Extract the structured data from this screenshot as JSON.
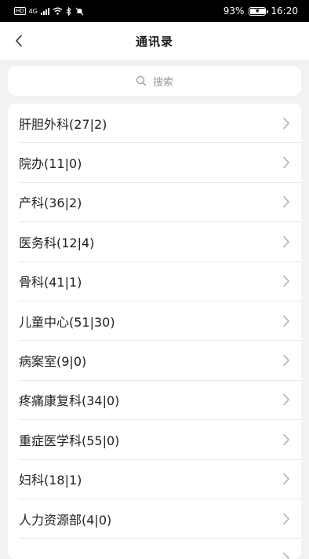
{
  "status_bar": {
    "network_tag": "HD",
    "network_type": "4G",
    "battery": "93%",
    "time": "16:20"
  },
  "header": {
    "title": "通讯录"
  },
  "search": {
    "placeholder": "搜索"
  },
  "departments": [
    {
      "label": "肝胆外科(27|2)"
    },
    {
      "label": "院办(11|0)"
    },
    {
      "label": "产科(36|2)"
    },
    {
      "label": "医务科(12|4)"
    },
    {
      "label": "骨科(41|1)"
    },
    {
      "label": "儿童中心(51|30)"
    },
    {
      "label": "病案室(9|0)"
    },
    {
      "label": "疼痛康复科(34|0)"
    },
    {
      "label": "重症医学科(55|0)"
    },
    {
      "label": "妇科(18|1)"
    },
    {
      "label": "人力资源部(4|0)"
    },
    {
      "label": ""
    }
  ]
}
